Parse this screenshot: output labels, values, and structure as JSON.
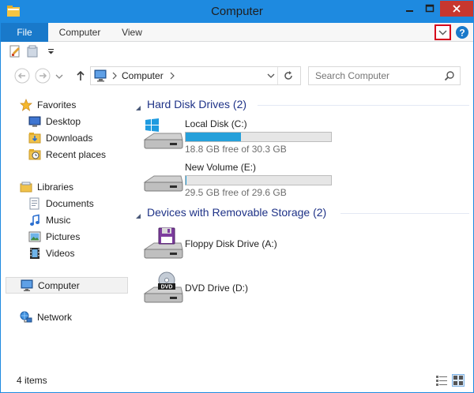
{
  "window": {
    "title": "Computer"
  },
  "ribbon": {
    "tabs": [
      {
        "label": "File"
      },
      {
        "label": "Computer"
      },
      {
        "label": "View"
      }
    ],
    "accent_color": "#1979ca",
    "toggle_highlight_color": "#d6001c"
  },
  "quick_access": {
    "items": [
      "properties-icon",
      "new-folder-icon",
      "customize-arrow-icon"
    ]
  },
  "address": {
    "path": "Computer",
    "search_placeholder": "Search Computer"
  },
  "nav": {
    "favorites": {
      "label": "Favorites",
      "items": [
        {
          "label": "Desktop"
        },
        {
          "label": "Downloads"
        },
        {
          "label": "Recent places"
        }
      ]
    },
    "libraries": {
      "label": "Libraries",
      "items": [
        {
          "label": "Documents"
        },
        {
          "label": "Music"
        },
        {
          "label": "Pictures"
        },
        {
          "label": "Videos"
        }
      ]
    },
    "computer": {
      "label": "Computer"
    },
    "network": {
      "label": "Network"
    }
  },
  "content": {
    "hard_disks": {
      "header": "Hard Disk Drives (2)",
      "drives": [
        {
          "name": "Local Disk (C:)",
          "free_text": "18.8 GB free of 30.3 GB",
          "used_fraction": 0.38
        },
        {
          "name": "New Volume (E:)",
          "free_text": "29.5 GB free of 29.6 GB",
          "used_fraction": 0.003
        }
      ]
    },
    "removable": {
      "header": "Devices with Removable Storage (2)",
      "drives": [
        {
          "name": "Floppy Disk Drive (A:)"
        },
        {
          "name": "DVD Drive (D:)"
        }
      ]
    }
  },
  "status": {
    "item_count": "4 items"
  }
}
